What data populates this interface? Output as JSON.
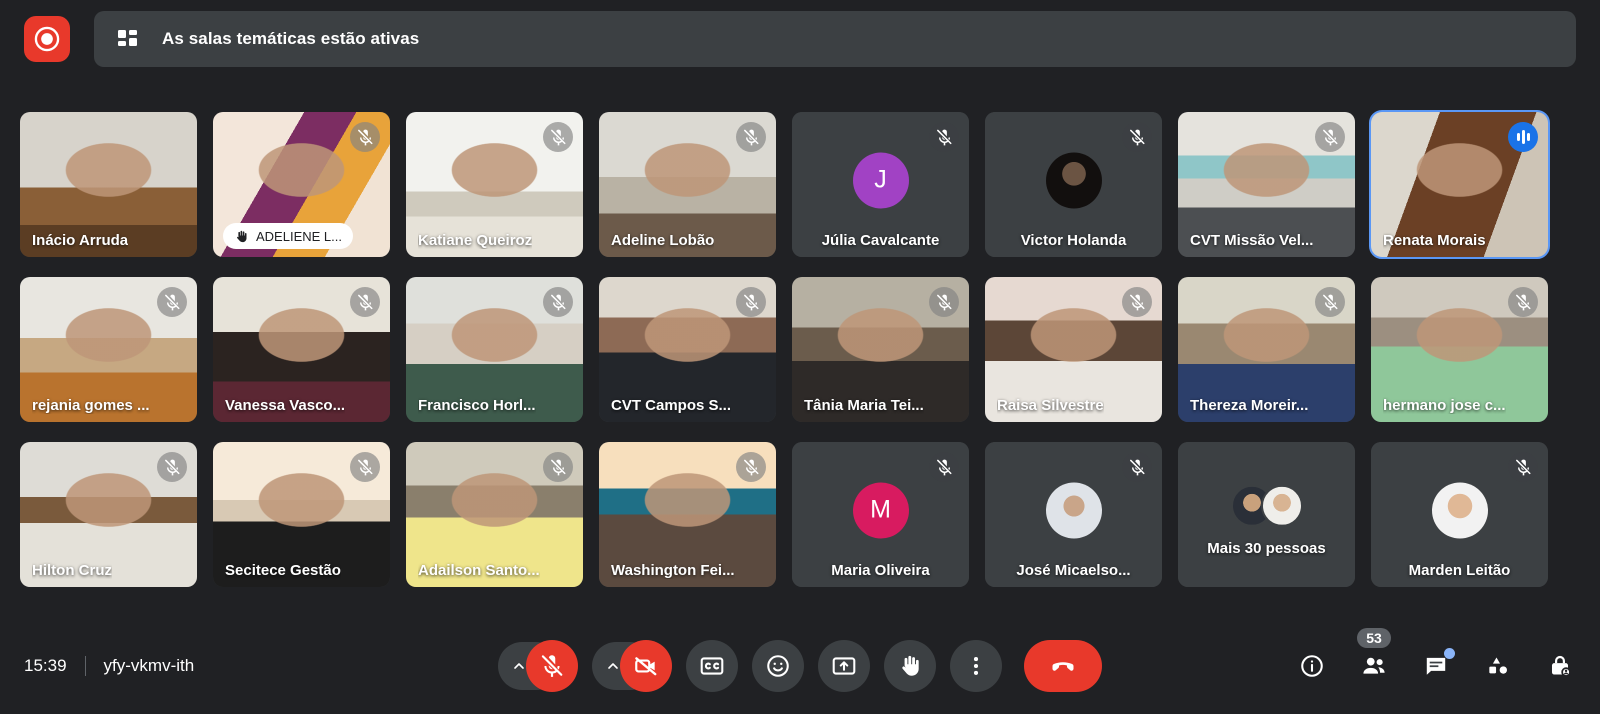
{
  "header": {
    "record_icon": "record-icon",
    "breakout_icon": "breakout-rooms-icon",
    "banner_text": "As salas temáticas estão ativas"
  },
  "grid": {
    "tiles": [
      {
        "name": "Inácio Arruda",
        "kind": "video",
        "muted": false,
        "hand": false,
        "speaking": false,
        "scene": "boardroom"
      },
      {
        "name": "ADELIENE L...",
        "kind": "video",
        "muted": true,
        "hand": true,
        "speaking": false,
        "scene": "banner-woman"
      },
      {
        "name": "Katiane Queiroz",
        "kind": "video",
        "muted": true,
        "hand": false,
        "speaking": false,
        "scene": "office-woman"
      },
      {
        "name": "Adeline Lobão",
        "kind": "video",
        "muted": true,
        "hand": false,
        "speaking": false,
        "scene": "blur-woman"
      },
      {
        "name": "Júlia Cavalcante",
        "kind": "initial",
        "muted": true,
        "hand": false,
        "speaking": false,
        "initial": "J",
        "avatar_color": "#a142c4"
      },
      {
        "name": "Victor Holanda",
        "kind": "photo",
        "muted": true,
        "hand": false,
        "speaking": false,
        "scene": "dark-portrait"
      },
      {
        "name": "CVT Missão Vel...",
        "kind": "video",
        "muted": true,
        "hand": false,
        "speaking": false,
        "scene": "man-glasses"
      },
      {
        "name": "Renata Morais",
        "kind": "video",
        "muted": false,
        "hand": false,
        "speaking": true,
        "scene": "woman-longhair"
      },
      {
        "name": "rejania gomes ...",
        "kind": "video",
        "muted": true,
        "hand": false,
        "speaking": false,
        "scene": "woman-white-wall"
      },
      {
        "name": "Vanessa Vasco...",
        "kind": "video",
        "muted": true,
        "hand": false,
        "speaking": false,
        "scene": "woman-blinds"
      },
      {
        "name": "Francisco Horl...",
        "kind": "video",
        "muted": true,
        "hand": false,
        "speaking": false,
        "scene": "man-whiteboard"
      },
      {
        "name": "CVT Campos S...",
        "kind": "video",
        "muted": true,
        "hand": false,
        "speaking": false,
        "scene": "woman-earphones"
      },
      {
        "name": "Tânia Maria Tei...",
        "kind": "video",
        "muted": true,
        "hand": false,
        "speaking": false,
        "scene": "woman-dark-room"
      },
      {
        "name": "Raisa Silvestre",
        "kind": "video",
        "muted": true,
        "hand": false,
        "speaking": false,
        "scene": "young-woman"
      },
      {
        "name": "Thereza Moreir...",
        "kind": "video",
        "muted": true,
        "hand": false,
        "speaking": false,
        "scene": "woman-floral"
      },
      {
        "name": "hermano jose c...",
        "kind": "video",
        "muted": true,
        "hand": false,
        "speaking": false,
        "scene": "man-green-shirt"
      },
      {
        "name": "Hilton Cruz",
        "kind": "video",
        "muted": true,
        "hand": false,
        "speaking": false,
        "scene": "elder-man"
      },
      {
        "name": "Secitece Gestão",
        "kind": "video",
        "muted": true,
        "hand": false,
        "speaking": false,
        "scene": "man-logo-bg"
      },
      {
        "name": "Adailson Santo...",
        "kind": "video",
        "muted": true,
        "hand": false,
        "speaking": false,
        "scene": "man-yellow-shirt"
      },
      {
        "name": "Washington Fei...",
        "kind": "video",
        "muted": true,
        "hand": false,
        "speaking": false,
        "scene": "man-50-banner"
      },
      {
        "name": "Maria Oliveira",
        "kind": "initial",
        "muted": true,
        "hand": false,
        "speaking": false,
        "initial": "M",
        "avatar_color": "#d81b60"
      },
      {
        "name": "José Micaelso...",
        "kind": "photo",
        "muted": true,
        "hand": false,
        "speaking": false,
        "scene": "man-beard-photo"
      },
      {
        "name": "Mais 30 pessoas",
        "kind": "more",
        "muted": false,
        "hand": false,
        "speaking": false,
        "count": 30
      },
      {
        "name": "Marden Leitão",
        "kind": "photo",
        "muted": true,
        "hand": false,
        "speaking": false,
        "scene": "smiling-man-photo"
      }
    ]
  },
  "bottom": {
    "time": "15:39",
    "meeting_code": "yfy-vkmv-ith",
    "controls": {
      "mic_options_icon": "chevron-up-icon",
      "mic_icon": "mic-off-icon",
      "camera_options_icon": "chevron-up-icon",
      "camera_icon": "camera-off-icon",
      "captions_icon": "closed-captions-icon",
      "reactions_icon": "emoji-icon",
      "present_icon": "present-screen-icon",
      "raise_hand_icon": "raise-hand-icon",
      "more_options_icon": "more-vertical-icon",
      "leave_call_icon": "hang-up-icon"
    },
    "right": {
      "info_icon": "info-icon",
      "people_icon": "people-icon",
      "people_count": "53",
      "chat_icon": "chat-icon",
      "chat_has_unread": true,
      "activities_icon": "activities-shapes-icon",
      "host_controls_icon": "host-lock-icon"
    }
  },
  "colors": {
    "app_background": "#202124",
    "surface": "#3c4043",
    "danger": "#e8392b",
    "accent_blue": "#1a73e8",
    "speaking_border": "#5a97f5"
  }
}
